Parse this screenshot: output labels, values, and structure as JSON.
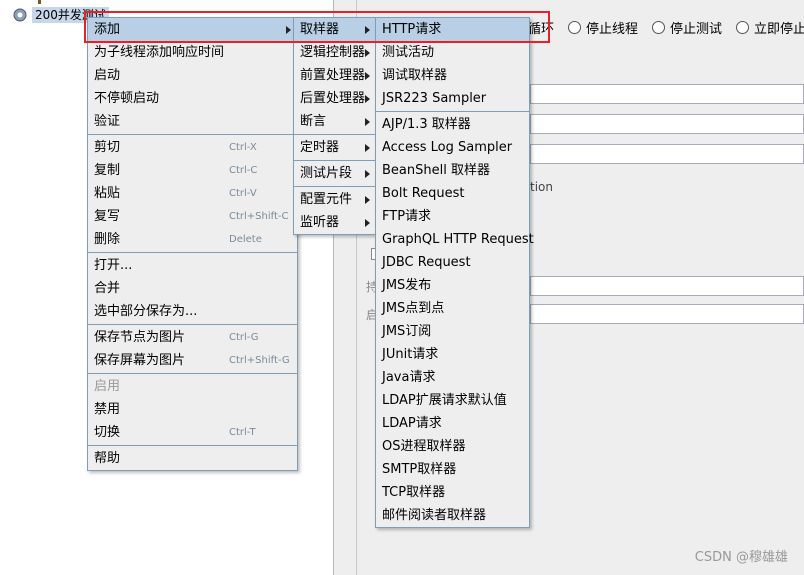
{
  "tree": {
    "node_label": "200并发测试"
  },
  "radio_options": [
    {
      "label": "循环"
    },
    {
      "label": "停止线程"
    },
    {
      "label": "停止测试"
    },
    {
      "label": "立即停止"
    }
  ],
  "panel_faint": {
    "text_ion": "tion",
    "label_1": "持",
    "label_2": "启"
  },
  "context_menu": {
    "items": [
      {
        "label": "添加",
        "shortcut": "",
        "submenu": true
      },
      {
        "label": "为子线程添加响应时间",
        "shortcut": "",
        "submenu": false
      },
      {
        "label": "启动",
        "shortcut": "",
        "submenu": false
      },
      {
        "label": "不停顿启动",
        "shortcut": "",
        "submenu": false
      },
      {
        "label": "验证",
        "shortcut": "",
        "submenu": false
      },
      {
        "label": "剪切",
        "shortcut": "Ctrl-X",
        "submenu": false
      },
      {
        "label": "复制",
        "shortcut": "Ctrl-C",
        "submenu": false
      },
      {
        "label": "粘贴",
        "shortcut": "Ctrl-V",
        "submenu": false
      },
      {
        "label": "复写",
        "shortcut": "Ctrl+Shift-C",
        "submenu": false
      },
      {
        "label": "删除",
        "shortcut": "Delete",
        "submenu": false
      },
      {
        "label": "打开...",
        "shortcut": "",
        "submenu": false
      },
      {
        "label": "合并",
        "shortcut": "",
        "submenu": false
      },
      {
        "label": "选中部分保存为...",
        "shortcut": "",
        "submenu": false
      },
      {
        "label": "保存节点为图片",
        "shortcut": "Ctrl-G",
        "submenu": false
      },
      {
        "label": "保存屏幕为图片",
        "shortcut": "Ctrl+Shift-G",
        "submenu": false
      },
      {
        "label": "启用",
        "shortcut": "",
        "submenu": false
      },
      {
        "label": "禁用",
        "shortcut": "",
        "submenu": false
      },
      {
        "label": "切换",
        "shortcut": "Ctrl-T",
        "submenu": false
      },
      {
        "label": "帮助",
        "shortcut": "",
        "submenu": false
      }
    ]
  },
  "add_menu": {
    "items": [
      {
        "label": "取样器"
      },
      {
        "label": "逻辑控制器"
      },
      {
        "label": "前置处理器"
      },
      {
        "label": "后置处理器"
      },
      {
        "label": "断言"
      },
      {
        "label": "定时器"
      },
      {
        "label": "测试片段"
      },
      {
        "label": "配置元件"
      },
      {
        "label": "监听器"
      }
    ]
  },
  "sampler_menu": {
    "items": [
      {
        "label": "HTTP请求"
      },
      {
        "label": "测试活动"
      },
      {
        "label": "调试取样器"
      },
      {
        "label": "JSR223 Sampler"
      },
      {
        "label": "AJP/1.3 取样器"
      },
      {
        "label": "Access Log Sampler"
      },
      {
        "label": "BeanShell 取样器"
      },
      {
        "label": "Bolt Request"
      },
      {
        "label": "FTP请求"
      },
      {
        "label": "GraphQL HTTP Request"
      },
      {
        "label": "JDBC Request"
      },
      {
        "label": "JMS发布"
      },
      {
        "label": "JMS点到点"
      },
      {
        "label": "JMS订阅"
      },
      {
        "label": "JUnit请求"
      },
      {
        "label": "Java请求"
      },
      {
        "label": "LDAP扩展请求默认值"
      },
      {
        "label": "LDAP请求"
      },
      {
        "label": "OS进程取样器"
      },
      {
        "label": "SMTP取样器"
      },
      {
        "label": "TCP取样器"
      },
      {
        "label": "邮件阅读者取样器"
      }
    ]
  },
  "watermark": "CSDN @穆雄雄",
  "colors": {
    "highlight": "#b8cfe5",
    "annotation_red": "#e2232a",
    "menu_bg": "#eeeeee",
    "menu_border": "#7f9db9"
  }
}
